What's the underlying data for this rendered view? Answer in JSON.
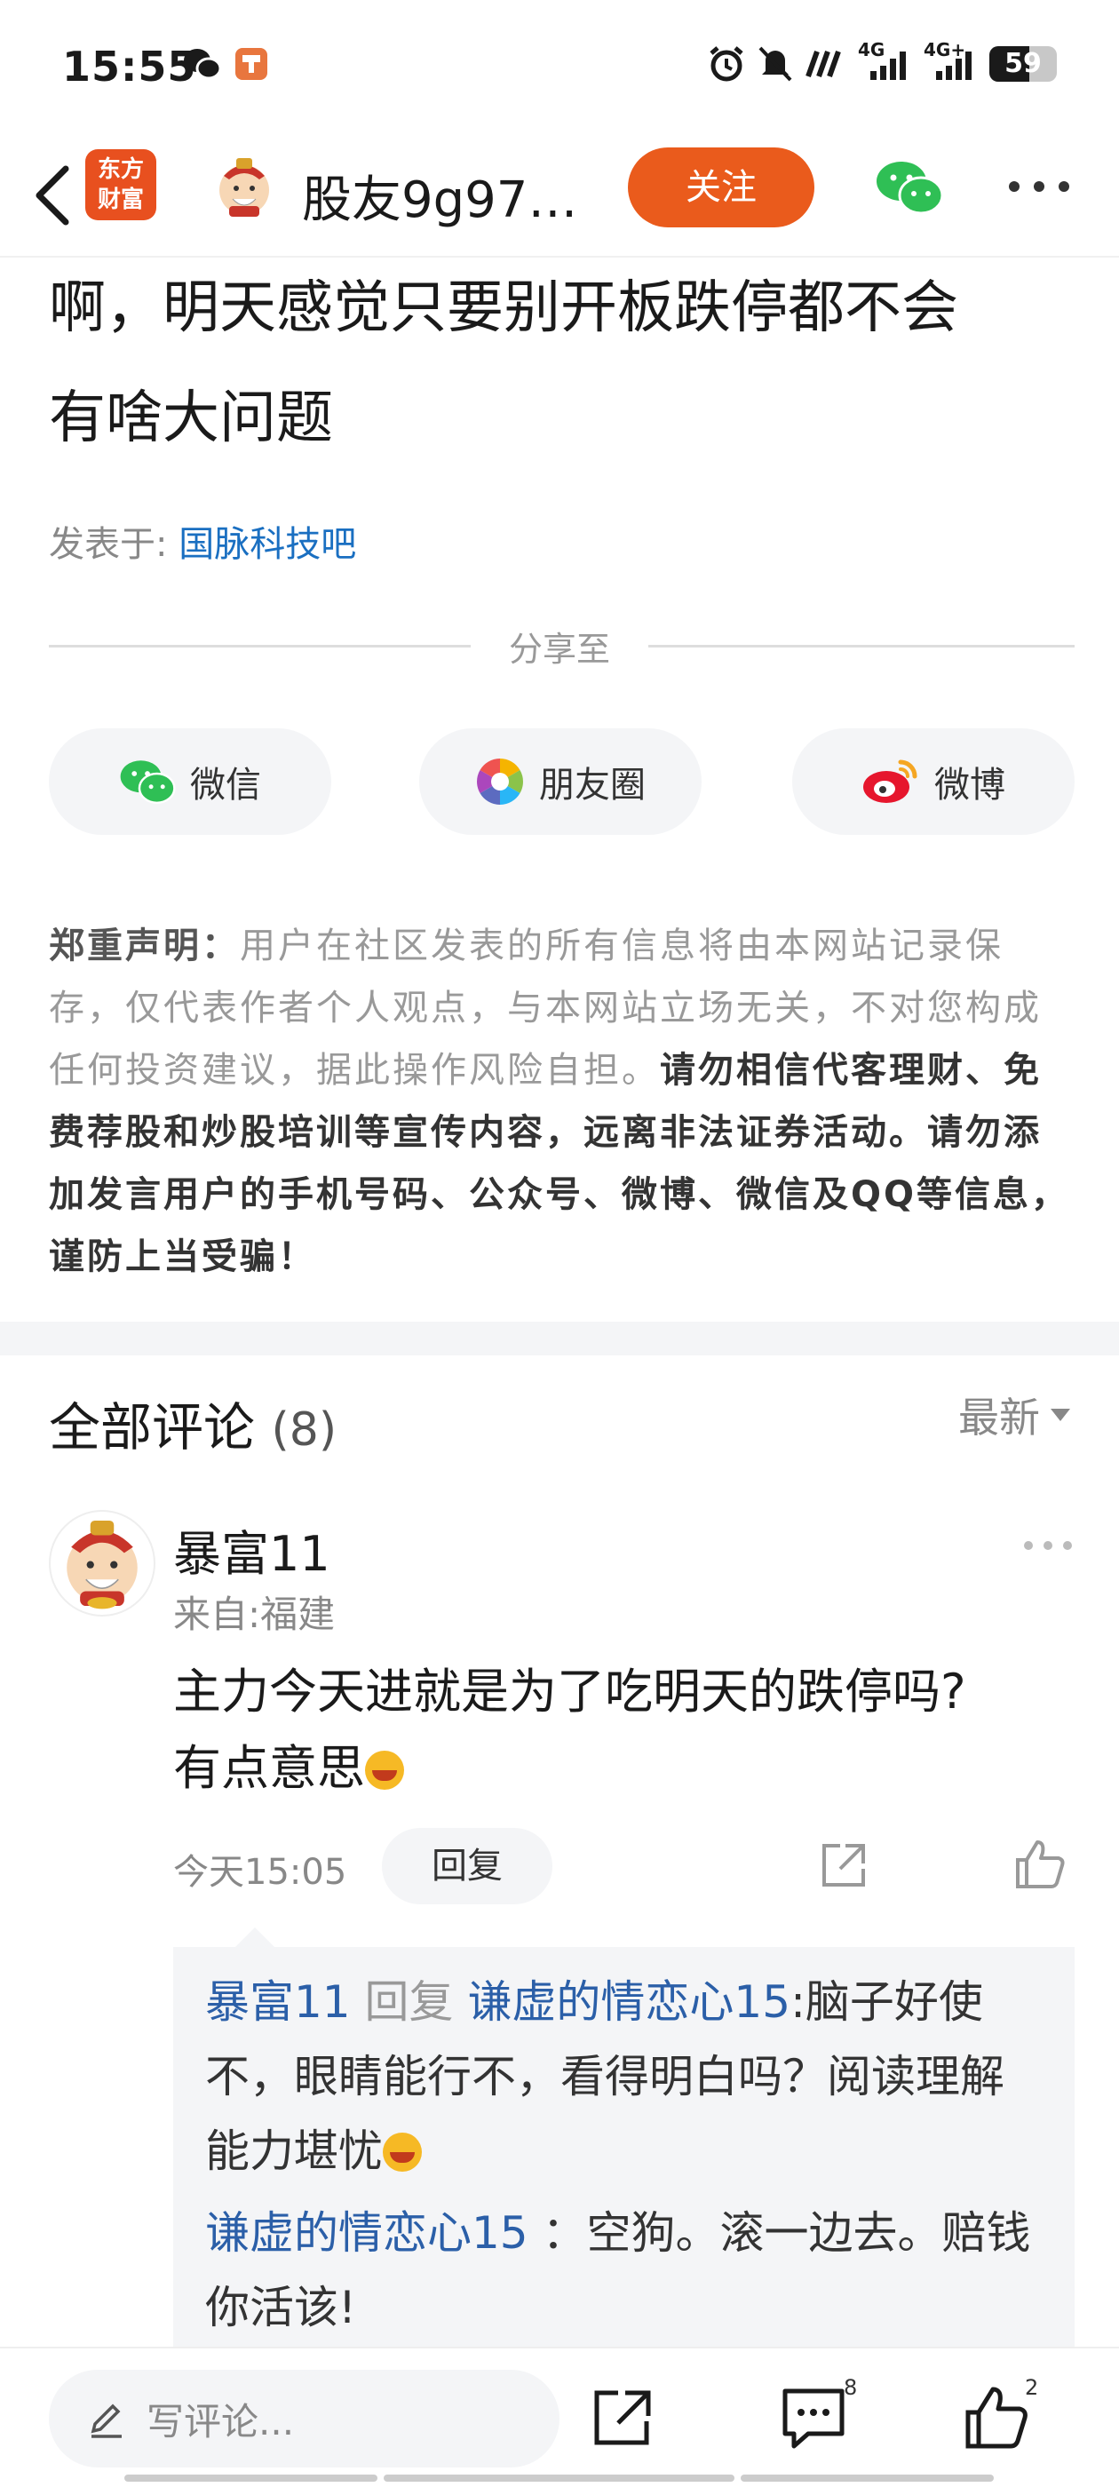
{
  "status_bar": {
    "time": "15:55",
    "net1": "4G",
    "net2": "4G+",
    "battery": "59",
    "battery_level": 0.59
  },
  "nav": {
    "app_logo_line1": "东方",
    "app_logo_line2": "财富",
    "username": "股友9g97…",
    "follow_label": "关注"
  },
  "article": {
    "text_line1": "啊，明天感觉只要别开板跌停都不会",
    "text_line2": "有啥大问题",
    "posted_label": "发表于:",
    "posted_bar": "国脉科技吧"
  },
  "share": {
    "title": "分享至",
    "buttons": [
      {
        "label": "微信",
        "icon": "wechat-icon"
      },
      {
        "label": "朋友圈",
        "icon": "moments-icon"
      },
      {
        "label": "微博",
        "icon": "weibo-icon"
      }
    ]
  },
  "disclaimer": {
    "heading": "郑重声明：",
    "plain": "用户在社区发表的所有信息将由本网站记录保存，仅代表作者个人观点，与本网站立场无关，不对您构成任何投资建议，据此操作风险自担。",
    "bold": "请勿相信代客理财、免费荐股和炒股培训等宣传内容，远离非法证券活动。请勿添加发言用户的手机号码、公众号、微博、微信及QQ等信息，谨防上当受骗！"
  },
  "comments": {
    "title": "全部评论",
    "count": "(8)",
    "sort_label": "最新",
    "items": [
      {
        "name": "暴富11",
        "from": "来自:福建",
        "body_line1": "主力今天进就是为了吃明天的跌停吗?",
        "body_line2": "有点意思",
        "time": "今天15:05",
        "reply_label": "回复",
        "replies": [
          {
            "user": "暴富11",
            "reply_word": "回复",
            "target": "谦虚的情恋心15",
            "text": ":脑子好使不，眼睛能行不，看得明白吗？阅读理解能力堪忧"
          },
          {
            "user": "谦虚的情恋心15",
            "text": " ：空狗。滚一边去。赔钱你活该!"
          }
        ]
      }
    ]
  },
  "bottom_bar": {
    "input_placeholder": "写评论...",
    "comment_badge": "8",
    "like_badge": "2"
  },
  "colors": {
    "accent": "#ea5b1c",
    "link": "#1a6fc1",
    "reply_user": "#2b5fa8"
  }
}
